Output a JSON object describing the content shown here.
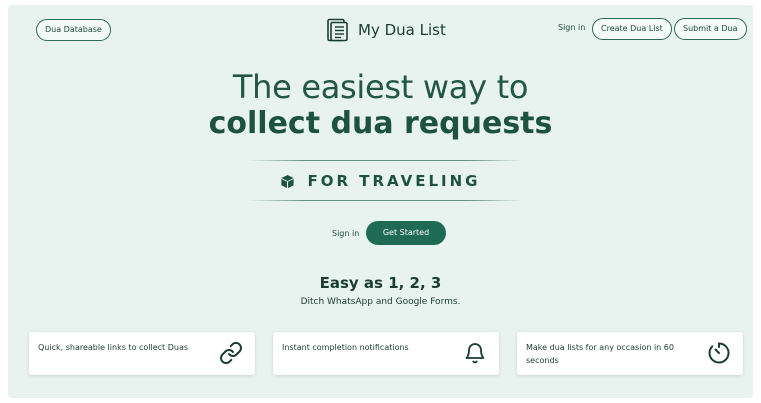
{
  "header": {
    "database_link": "Dua Database",
    "brand_name": "My Dua List",
    "sign_in": "Sign in",
    "create_list": "Create Dua List",
    "submit_dua": "Submit a Dua",
    "brand_icon": "checklist-icon"
  },
  "hero": {
    "line1": "The easiest way to",
    "line2": "collect dua requests",
    "badge_icon": "box-icon",
    "badge_text": "FOR TRAVELING"
  },
  "cta": {
    "sign_in": "Sign in",
    "get_started": "Get Started"
  },
  "steps": {
    "heading": "Easy as 1, 2, 3",
    "subheading": "Ditch WhatsApp and Google Forms."
  },
  "features": [
    {
      "text": "Quick, shareable links to collect Duas",
      "icon": "link-icon"
    },
    {
      "text": "Instant completion notifications",
      "icon": "bell-icon"
    },
    {
      "text": "Make dua lists for any occasion in 60 seconds",
      "icon": "timer-icon"
    }
  ],
  "colors": {
    "background": "#e8f2ee",
    "accent": "#1f6a52",
    "text": "#1a3d31"
  }
}
